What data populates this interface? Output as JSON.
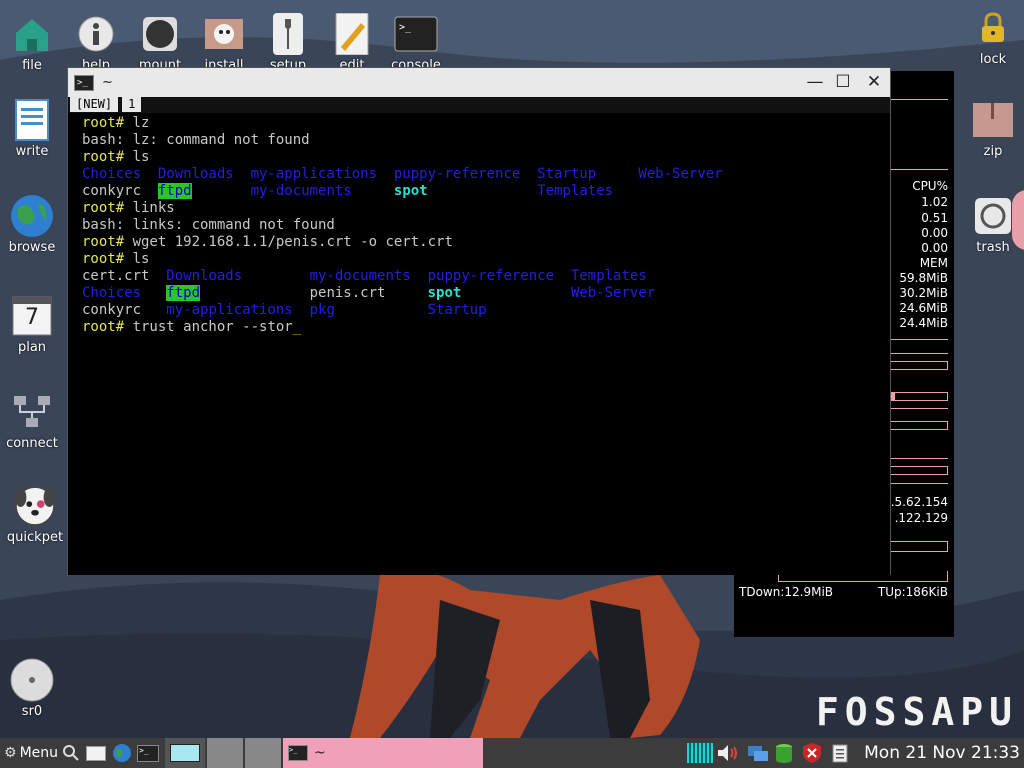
{
  "desktop": {
    "top_icons": [
      {
        "label": "file"
      },
      {
        "label": "help"
      },
      {
        "label": "mount"
      },
      {
        "label": "install"
      },
      {
        "label": "setup"
      },
      {
        "label": "edit"
      },
      {
        "label": "console"
      }
    ],
    "left_icons": [
      {
        "label": "write"
      },
      {
        "label": "browse"
      },
      {
        "label": "plan",
        "day": "7"
      },
      {
        "label": "connect"
      },
      {
        "label": "quickpet"
      },
      {
        "label": "sr0"
      }
    ],
    "right_icons": [
      {
        "label": "lock"
      },
      {
        "label": "zip"
      },
      {
        "label": "trash"
      }
    ],
    "brand": "FOSSAPU"
  },
  "terminal": {
    "title": "~",
    "title_icon": ">_",
    "tabs": [
      "[NEW]",
      "1"
    ],
    "buttons": {
      "minimize": "—",
      "maximize": "☐",
      "close": "✕"
    },
    "lines": [
      [
        {
          "c": "prompt",
          "t": "root# "
        },
        {
          "c": "plain",
          "t": "lz"
        }
      ],
      [
        {
          "c": "plain",
          "t": "bash: lz: command not found"
        }
      ],
      [
        {
          "c": "prompt",
          "t": "root# "
        },
        {
          "c": "plain",
          "t": "ls"
        }
      ],
      [
        {
          "c": "dir",
          "t": "Choices  "
        },
        {
          "c": "dir",
          "t": "Downloads  "
        },
        {
          "c": "dir",
          "t": "my-applications  "
        },
        {
          "c": "dir",
          "t": "puppy-reference  "
        },
        {
          "c": "dir",
          "t": "Startup     "
        },
        {
          "c": "dir",
          "t": "Web-Server"
        }
      ],
      [
        {
          "c": "plain",
          "t": "conkyrc  "
        },
        {
          "c": "hl",
          "t": "ftpd"
        },
        {
          "c": "plain",
          "t": "       "
        },
        {
          "c": "dir",
          "t": "my-documents     "
        },
        {
          "c": "exec",
          "t": "spot"
        },
        {
          "c": "plain",
          "t": "             "
        },
        {
          "c": "dir",
          "t": "Templates"
        }
      ],
      [
        {
          "c": "prompt",
          "t": "root# "
        },
        {
          "c": "plain",
          "t": "links"
        }
      ],
      [
        {
          "c": "plain",
          "t": "bash: links: command not found"
        }
      ],
      [
        {
          "c": "prompt",
          "t": "root# "
        },
        {
          "c": "plain",
          "t": "wget 192.168.1.1/penis.crt -o cert.crt"
        }
      ],
      [
        {
          "c": "prompt",
          "t": "root# "
        },
        {
          "c": "plain",
          "t": "ls"
        }
      ],
      [
        {
          "c": "plain",
          "t": "cert.crt  "
        },
        {
          "c": "dir",
          "t": "Downloads        "
        },
        {
          "c": "dir",
          "t": "my-documents  "
        },
        {
          "c": "dir",
          "t": "puppy-reference  "
        },
        {
          "c": "dir",
          "t": "Templates"
        }
      ],
      [
        {
          "c": "dir",
          "t": "Choices   "
        },
        {
          "c": "hl",
          "t": "ftpd"
        },
        {
          "c": "plain",
          "t": "             "
        },
        {
          "c": "plain",
          "t": "penis.crt     "
        },
        {
          "c": "exec",
          "t": "spot"
        },
        {
          "c": "plain",
          "t": "             "
        },
        {
          "c": "dir",
          "t": "Web-Server"
        }
      ],
      [
        {
          "c": "plain",
          "t": "conkyrc   "
        },
        {
          "c": "dir",
          "t": "my-applications  "
        },
        {
          "c": "dir",
          "t": "pkg           "
        },
        {
          "c": "dir",
          "t": "Startup"
        }
      ],
      [
        {
          "c": "prompt",
          "t": "root# "
        },
        {
          "c": "plain",
          "t": "trust anchor --stor"
        },
        {
          "c": "cursor",
          "t": "_"
        }
      ]
    ]
  },
  "conky": {
    "cpu_label": "CPU%",
    "cpu": [
      "1.02",
      "0.51",
      "0.00",
      "0.00"
    ],
    "mem_label": "MEM",
    "mem": [
      "59.8MiB",
      "30.2MiB",
      "24.6MiB",
      "24.4MiB"
    ],
    "ip1": ".5.62.154",
    "ip2": ".122.129",
    "tdown": "TDown:12.9MiB",
    "tup": "TUp:186KiB"
  },
  "taskbar": {
    "menu_label": "Menu",
    "task_label": "~",
    "clock": "Mon 21 Nov 21:33"
  }
}
